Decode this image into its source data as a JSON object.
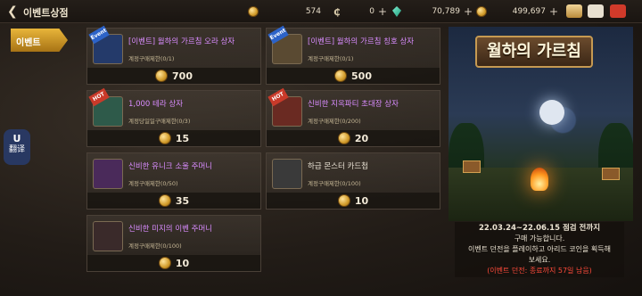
{
  "header": {
    "title": "이벤트상점",
    "currencies": [
      {
        "icon": "gold-coin-icon",
        "value": "574"
      },
      {
        "icon": "c-currency-icon",
        "value": "0"
      },
      {
        "icon": "green-gem-icon",
        "value": "70,789"
      },
      {
        "icon": "gold-coin-icon",
        "value": "499,697"
      }
    ]
  },
  "sidebar": {
    "tab_label": "이벤트"
  },
  "translate": {
    "label": "翻译"
  },
  "items": [
    {
      "name": "[이벤트] 월하의 가르침 오라 상자",
      "limit": "계정구매제한(0/1)",
      "price": "700",
      "badge": "Event"
    },
    {
      "name": "[이벤트] 월하의 가르침 칭호 상자",
      "limit": "계정구매제한(0/1)",
      "price": "500",
      "badge": "Event"
    },
    {
      "name": "1,000 테라 상자",
      "limit": "계정당일일구매제한(0/3)",
      "price": "15",
      "badge": "HOT"
    },
    {
      "name": "신비한 지옥파티 초대장 상자",
      "limit": "계정구매제한(0/200)",
      "price": "20",
      "badge": "HOT"
    },
    {
      "name": "신비한 유니크 소울 주머니",
      "limit": "계정구매제한(0/50)",
      "price": "35",
      "badge": ""
    },
    {
      "name": "하급 몬스터 카드첩",
      "limit": "계정구매제한(0/100)",
      "price": "10",
      "badge": ""
    },
    {
      "name": "신비한 미지의 이벤 주머니",
      "limit": "계정구매제한(0/100)",
      "price": "10",
      "badge": ""
    }
  ],
  "banner": {
    "logo_text": "월하의 가르침",
    "date_range": "22.03.24~22.06.15 점검 전까지",
    "line1": "구매 가능합니다.",
    "line2": "이벤트 던전을 플레이하고 아리드 코인을 획득해",
    "line3": "보세요.",
    "remaining": "(이벤트 던전: 종료까지 57일 남음)"
  },
  "colors": {
    "accent": "#e8b53a",
    "item_name_purple": "#d98cff",
    "remaining_red": "#ff4a3a"
  }
}
